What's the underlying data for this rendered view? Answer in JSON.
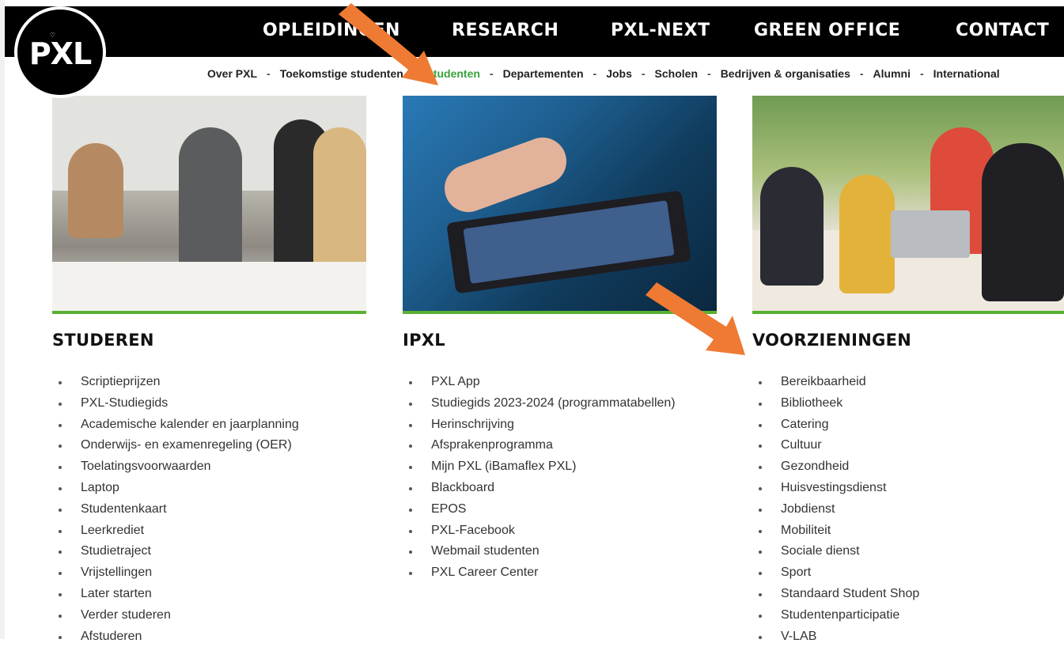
{
  "logo": {
    "text": "PXL"
  },
  "main_nav": [
    "OPLEIDINGEN",
    "RESEARCH",
    "PXL-NEXT",
    "GREEN OFFICE",
    "CONTACT"
  ],
  "sub_nav": [
    {
      "label": "Over PXL",
      "active": false
    },
    {
      "label": "Toekomstige studenten",
      "active": false
    },
    {
      "label": "Studenten",
      "active": true
    },
    {
      "label": "Departementen",
      "active": false
    },
    {
      "label": "Jobs",
      "active": false
    },
    {
      "label": "Scholen",
      "active": false
    },
    {
      "label": "Bedrijven & organisaties",
      "active": false
    },
    {
      "label": "Alumni",
      "active": false
    },
    {
      "label": "International",
      "active": false
    }
  ],
  "columns": [
    {
      "title": "STUDEREN",
      "items": [
        "Scriptieprijzen",
        "PXL-Studiegids",
        "Academische kalender en jaarplanning",
        "Onderwijs- en examenregeling (OER)",
        "Toelatingsvoorwaarden",
        "Laptop",
        "Studentenkaart",
        "Leerkrediet",
        "Studietraject",
        "Vrijstellingen",
        "Later starten",
        "Verder studeren",
        "Afstuderen"
      ]
    },
    {
      "title": "IPXL",
      "items": [
        "PXL App",
        "Studiegids 2023-2024 (programmatabellen)",
        "Herinschrijving",
        "Afsprakenprogramma",
        "Mijn PXL (iBamaflex PXL)",
        "Blackboard",
        "EPOS",
        "PXL-Facebook",
        "Webmail studenten",
        "PXL Career Center"
      ]
    },
    {
      "title": "VOORZIENINGEN",
      "items": [
        "Bereikbaarheid",
        "Bibliotheek",
        "Catering",
        "Cultuur",
        "Gezondheid",
        "Huisvestingsdienst",
        "Jobdienst",
        "Mobiliteit",
        "Sociale dienst",
        "Sport",
        "Standaard Student Shop",
        "Studentenparticipatie",
        "V-LAB"
      ]
    }
  ],
  "colors": {
    "nav_bg": "#000000",
    "active_link": "#3aa23a",
    "green_bar": "#5ab031",
    "annotation_arrow": "#ee7a33"
  }
}
